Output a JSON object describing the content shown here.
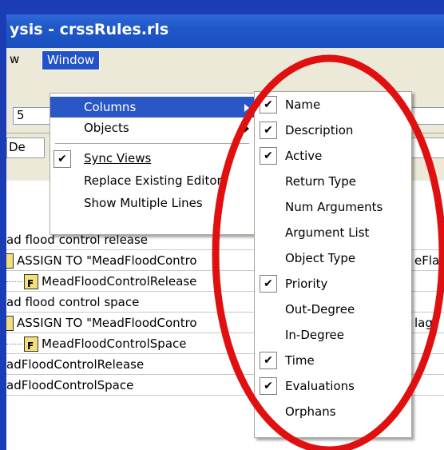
{
  "window": {
    "title": "ysis - crssRules.rls"
  },
  "menubar": {
    "view_label": "w",
    "window_label": "Window"
  },
  "toolbar": {
    "field_value": "5"
  },
  "tabs": {
    "de_label": "De"
  },
  "tree": {
    "rows": [
      {
        "text": "ad flood control release"
      },
      {
        "text": "ASSIGN TO \"MeadFloodContro"
      },
      {
        "text": "MeadFloodControlRelease"
      },
      {
        "text": "ad flood control space"
      },
      {
        "text": "ASSIGN TO \"MeadFloodContro"
      },
      {
        "text": "MeadFloodControlSpace"
      },
      {
        "text": "adFloodControlRelease"
      },
      {
        "text": "adFloodControlSpace"
      }
    ],
    "right_text_1": "eFla",
    "right_text_2": "lag",
    "file_icon_letter": "F"
  },
  "window_menu": {
    "items": [
      {
        "label": "Columns",
        "submenu": true,
        "highlighted": true
      },
      {
        "label": "Objects",
        "submenu": true
      },
      {
        "label": "Sync Views",
        "checked": true
      },
      {
        "label": "Replace Existing Editor"
      },
      {
        "label": "Show Multiple Lines"
      }
    ]
  },
  "columns_menu": {
    "items": [
      {
        "label": "Name",
        "checked": true
      },
      {
        "label": "Description",
        "checked": true
      },
      {
        "label": "Active",
        "checked": true
      },
      {
        "label": "Return Type",
        "checked": false
      },
      {
        "label": "Num Arguments",
        "checked": false
      },
      {
        "label": "Argument List",
        "checked": false
      },
      {
        "label": "Object Type",
        "checked": false
      },
      {
        "label": "Priority",
        "checked": true
      },
      {
        "label": "Out-Degree",
        "checked": false
      },
      {
        "label": "In-Degree",
        "checked": false
      },
      {
        "label": "Time",
        "checked": true
      },
      {
        "label": "Evaluations",
        "checked": true
      },
      {
        "label": "Orphans",
        "checked": false
      }
    ]
  },
  "colors": {
    "slide_background": "#1f3fb8",
    "highlight": "#2a57c6",
    "annotation": "#e01010"
  },
  "icons": {
    "check": "✔",
    "submenu_arrow": "chevron-right-icon"
  }
}
